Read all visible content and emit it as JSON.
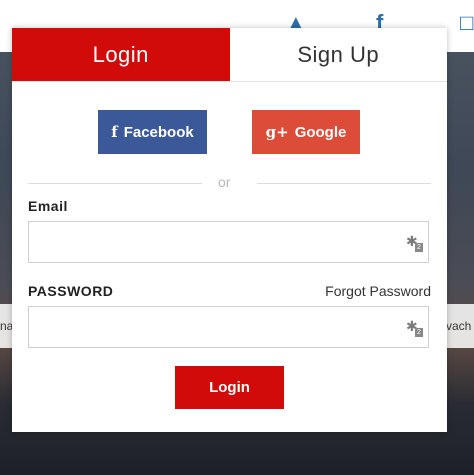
{
  "tabs": {
    "login": "Login",
    "signup": "Sign Up"
  },
  "social": {
    "facebook_icon": "f",
    "facebook_label": "Facebook",
    "google_icon": "g+",
    "google_label": "Google"
  },
  "divider": {
    "text": "or"
  },
  "email": {
    "label": "Email",
    "value": "",
    "placeholder": ""
  },
  "password": {
    "label": "PASSWORD",
    "value": "",
    "placeholder": "",
    "forgot": "Forgot Password"
  },
  "submit": {
    "label": "Login"
  },
  "background": {
    "left_text": "na",
    "right_text": "vach"
  },
  "colors": {
    "accent": "#d10a0a",
    "facebook": "#3b5998",
    "google": "#dd4b39"
  }
}
